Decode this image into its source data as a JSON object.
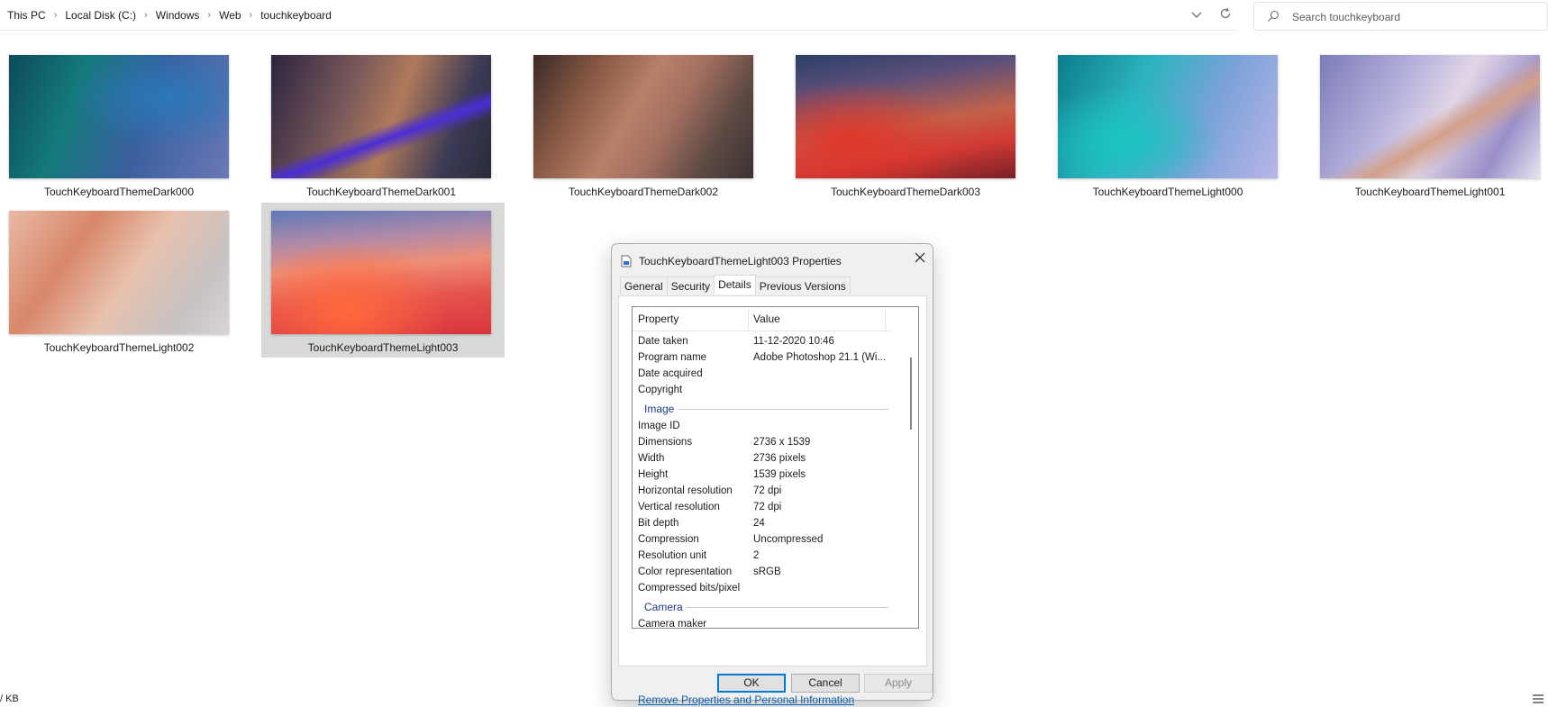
{
  "address": {
    "crumbs": [
      "This PC",
      "Local Disk (C:)",
      "Windows",
      "Web",
      "touchkeyboard"
    ],
    "separator": "›"
  },
  "search": {
    "placeholder": "Search touchkeyboard"
  },
  "files": [
    {
      "name": "TouchKeyboardThemeDark000"
    },
    {
      "name": "TouchKeyboardThemeDark001"
    },
    {
      "name": "TouchKeyboardThemeDark002"
    },
    {
      "name": "TouchKeyboardThemeDark003"
    },
    {
      "name": "TouchKeyboardThemeLight000"
    },
    {
      "name": "TouchKeyboardThemeLight001"
    },
    {
      "name": "TouchKeyboardThemeLight002"
    },
    {
      "name": "TouchKeyboardThemeLight003",
      "selected": true
    }
  ],
  "status": {
    "left": "/ KB"
  },
  "dialog": {
    "title": "TouchKeyboardThemeLight003 Properties",
    "tabs": [
      "General",
      "Security",
      "Details",
      "Previous Versions"
    ],
    "active_tab": "Details",
    "columns": {
      "property": "Property",
      "value": "Value"
    },
    "rows": [
      {
        "k": "Date taken",
        "v": "11-12-2020 10:46"
      },
      {
        "k": "Program name",
        "v": "Adobe Photoshop 21.1 (Wi..."
      },
      {
        "k": "Date acquired",
        "v": ""
      },
      {
        "k": "Copyright",
        "v": ""
      }
    ],
    "group_image": "Image",
    "image_rows": [
      {
        "k": "Image ID",
        "v": ""
      },
      {
        "k": "Dimensions",
        "v": "2736 x 1539"
      },
      {
        "k": "Width",
        "v": "2736 pixels"
      },
      {
        "k": "Height",
        "v": "1539 pixels"
      },
      {
        "k": "Horizontal resolution",
        "v": "72 dpi"
      },
      {
        "k": "Vertical resolution",
        "v": "72 dpi"
      },
      {
        "k": "Bit depth",
        "v": "24"
      },
      {
        "k": "Compression",
        "v": "Uncompressed"
      },
      {
        "k": "Resolution unit",
        "v": "2"
      },
      {
        "k": "Color representation",
        "v": "sRGB"
      },
      {
        "k": "Compressed bits/pixel",
        "v": ""
      }
    ],
    "group_camera": "Camera",
    "camera_rows": [
      {
        "k": "Camera maker",
        "v": ""
      }
    ],
    "remove_link": "Remove Properties and Personal Information",
    "buttons": {
      "ok": "OK",
      "cancel": "Cancel",
      "apply": "Apply"
    }
  }
}
